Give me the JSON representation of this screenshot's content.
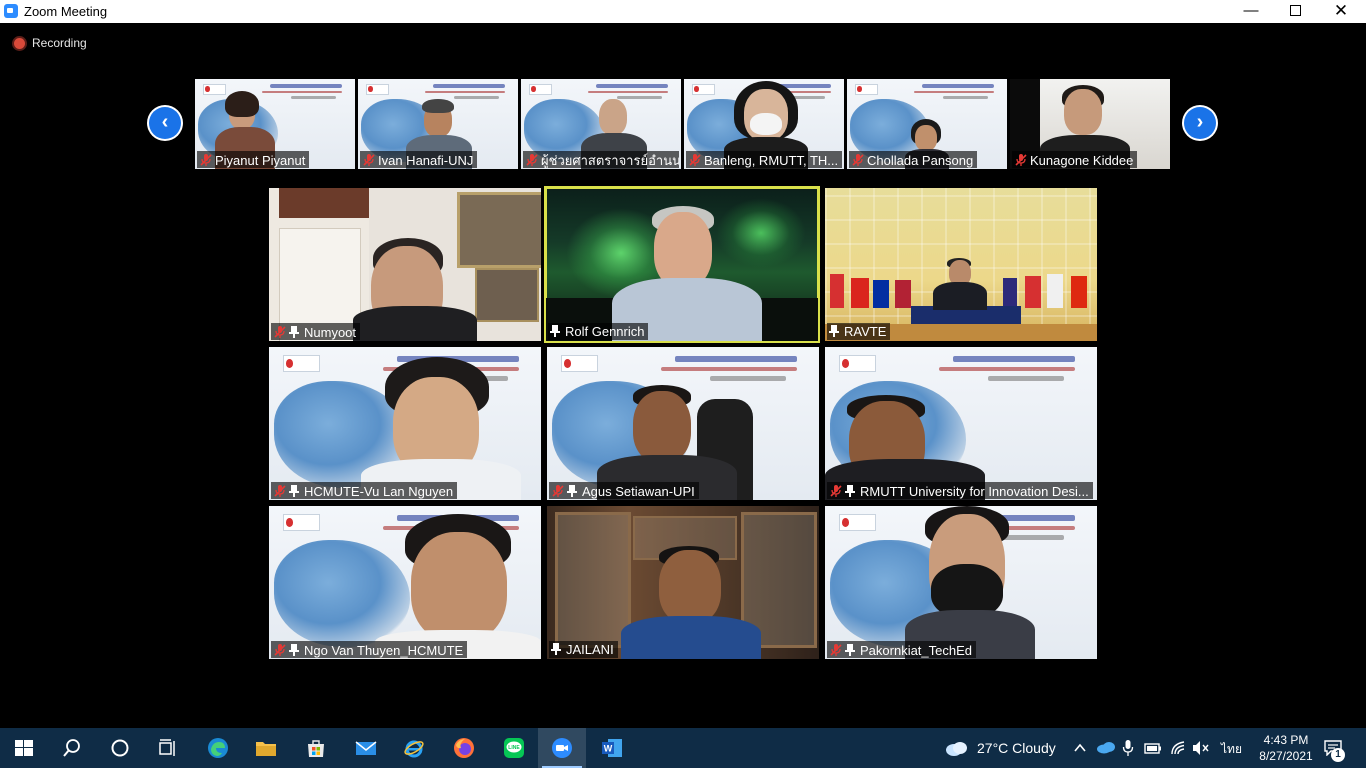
{
  "window": {
    "title": "Zoom Meeting",
    "min_symbol": "—",
    "close_symbol": "✕"
  },
  "recording": {
    "label": "Recording"
  },
  "strip": {
    "prev_symbol": "‹",
    "next_symbol": "›",
    "participants": [
      {
        "name": "Piyanut Piyanut",
        "muted": true
      },
      {
        "name": "Ivan Hanafi-UNJ",
        "muted": true
      },
      {
        "name": "ผู้ช่วยศาสตราจารย์อำนน...",
        "muted": true
      },
      {
        "name": "Banleng, RMUTT, TH...",
        "muted": true
      },
      {
        "name": "Chollada Pansong",
        "muted": true
      },
      {
        "name": "Kunagone Kiddee",
        "muted": true
      }
    ]
  },
  "grid": {
    "participants": [
      {
        "name": "Numyoot",
        "muted": true,
        "pinned": true
      },
      {
        "name": "Rolf Gennrich",
        "muted": false,
        "pinned": true,
        "active": true
      },
      {
        "name": "RAVTE",
        "muted": false,
        "pinned": true
      },
      {
        "name": "HCMUTE-Vu Lan Nguyen",
        "muted": true,
        "pinned": true
      },
      {
        "name": "Agus Setiawan-UPI",
        "muted": true,
        "pinned": true
      },
      {
        "name": "RMUTT University for Innovation Desi...",
        "muted": true,
        "pinned": true
      },
      {
        "name": "Ngo Van Thuyen_HCMUTE",
        "muted": true,
        "pinned": true
      },
      {
        "name": "JAILANI",
        "muted": false,
        "pinned": true
      },
      {
        "name": "Pakornkiat_TechEd",
        "muted": true,
        "pinned": true
      }
    ]
  },
  "taskbar": {
    "apps": [
      {
        "icon": "windows-start-icon"
      },
      {
        "icon": "search-icon"
      },
      {
        "icon": "cortana-icon"
      },
      {
        "icon": "task-view-icon"
      },
      {
        "icon": "edge-icon"
      },
      {
        "icon": "file-explorer-icon"
      },
      {
        "icon": "microsoft-store-icon"
      },
      {
        "icon": "mail-icon"
      },
      {
        "icon": "internet-explorer-icon"
      },
      {
        "icon": "firefox-icon"
      },
      {
        "icon": "line-icon"
      },
      {
        "icon": "zoom-icon",
        "active": true
      },
      {
        "icon": "word-icon"
      }
    ],
    "weather": "27°C  Cloudy",
    "language": "ไทย",
    "time": "4:43 PM",
    "date": "8/27/2021",
    "notification_count": "1"
  },
  "colors": {
    "taskbar_bg": "#0f2c46",
    "active_speaker_border": "#d9e04a",
    "nav_arrow": "#1a73e8",
    "recording_dot": "#d94a3a"
  }
}
